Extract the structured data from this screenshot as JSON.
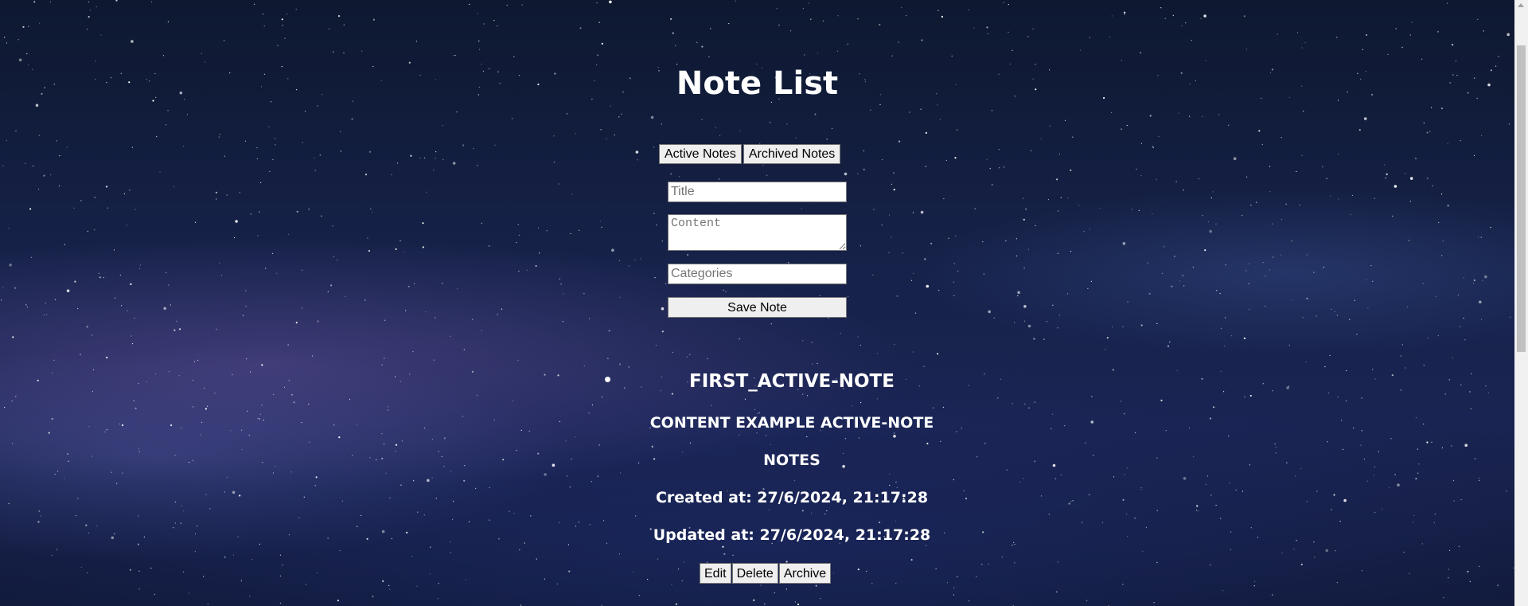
{
  "page": {
    "title": "Note List"
  },
  "tabs": {
    "active_label": "Active Notes",
    "archived_label": "Archived Notes"
  },
  "form": {
    "title_placeholder": "Title",
    "content_placeholder": "Content",
    "categories_placeholder": "Categories",
    "save_label": "Save Note"
  },
  "notes": [
    {
      "title": "FIRST_ACTIVE-NOTE",
      "content": "CONTENT EXAMPLE ACTIVE-NOTE",
      "categories": "NOTES",
      "created": "Created at: 27/6/2024, 21:17:28",
      "updated": "Updated at: 27/6/2024, 21:17:28",
      "edit_label": "Edit",
      "delete_label": "Delete",
      "archive_label": "Archive"
    }
  ],
  "colors": {
    "text": "#ffffff",
    "button_bg": "#efefef",
    "scrollbar_track": "#f1f1f1",
    "scrollbar_thumb": "#c1c1c1"
  },
  "icons": {
    "scroll_up": "triangle-up-icon"
  }
}
